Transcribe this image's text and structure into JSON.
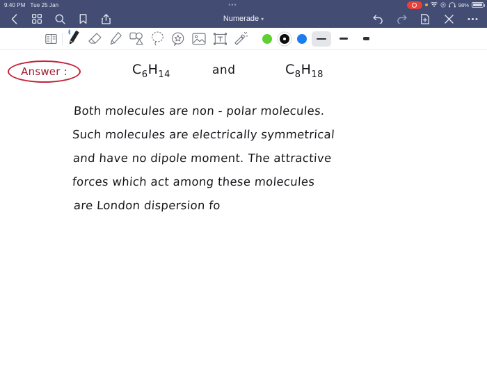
{
  "status_bar": {
    "time": "9:40 PM",
    "date": "Tue 25 Jan",
    "recording_icon": "record-dot-icon",
    "orange_dot_icon": "orange-indicator-dot-icon",
    "wifi_icon": "wifi-icon",
    "settings_icon": "gear-icon",
    "headphones_icon": "headphones-icon",
    "battery_percent": "98%",
    "battery_icon": "battery-icon",
    "handle_dots": "•••"
  },
  "nav_bar": {
    "title": "Numerade",
    "title_chevron": "▾",
    "left_items": [
      {
        "name": "back-button",
        "icon": "chevron-left-icon"
      },
      {
        "name": "thumbnails-button",
        "icon": "grid-icon"
      },
      {
        "name": "search-button",
        "icon": "search-icon"
      },
      {
        "name": "bookmark-button",
        "icon": "bookmark-icon"
      },
      {
        "name": "share-button",
        "icon": "share-icon"
      }
    ],
    "right_items": [
      {
        "name": "undo-button",
        "icon": "undo-arrow-icon"
      },
      {
        "name": "redo-button",
        "icon": "redo-arrow-icon"
      },
      {
        "name": "add-page-button",
        "icon": "document-plus-icon"
      },
      {
        "name": "close-button",
        "icon": "close-x-icon"
      },
      {
        "name": "more-button",
        "icon": "ellipsis-icon"
      }
    ]
  },
  "toolbar": {
    "tools": [
      {
        "name": "page-layout-tool",
        "icon": "page-layout-icon",
        "selected": false
      },
      {
        "name": "pen-tool",
        "icon": "pen-icon",
        "selected": true,
        "badge": "bluetooth-icon"
      },
      {
        "name": "eraser-tool",
        "icon": "eraser-icon",
        "selected": false
      },
      {
        "name": "highlighter-tool",
        "icon": "highlighter-icon",
        "selected": false
      },
      {
        "name": "shapes-tool",
        "icon": "shapes-icon",
        "selected": false
      },
      {
        "name": "lasso-tool",
        "icon": "lasso-icon",
        "selected": false
      },
      {
        "name": "sticker-tool",
        "icon": "sticker-star-icon",
        "selected": false
      },
      {
        "name": "image-tool",
        "icon": "image-icon",
        "selected": false
      },
      {
        "name": "text-tool",
        "icon": "text-box-icon",
        "selected": false
      },
      {
        "name": "laser-tool",
        "icon": "magic-wand-icon",
        "selected": false
      }
    ],
    "colors": [
      {
        "name": "color-swatch-green",
        "hex": "#5fd02f",
        "active": false
      },
      {
        "name": "color-swatch-black",
        "hex": "#0d0d0d",
        "active": true
      },
      {
        "name": "color-swatch-blue",
        "hex": "#1a7ef0",
        "active": false
      }
    ],
    "stroke_widths": [
      {
        "name": "stroke-width-thin",
        "active": true,
        "w": 14,
        "h": 2
      },
      {
        "name": "stroke-width-medium",
        "active": false,
        "w": 12,
        "h": 3
      },
      {
        "name": "stroke-width-thick",
        "active": false,
        "w": 9,
        "h": 4
      }
    ]
  },
  "canvas": {
    "answer_label": "Answer :",
    "answer_circle_color": "#c12237",
    "formula_left": "C6H14",
    "formula_left_parts": {
      "c": "C",
      "c_sub": "6",
      "h": "H",
      "h_sub": "14"
    },
    "conjunction": "and",
    "formula_right_parts": {
      "c": "C",
      "c_sub": "8",
      "h": "H",
      "h_sub": "18"
    },
    "lines": [
      "Both   molecules   are    non - polar   molecules.",
      "Such   molecules   are   electrically   symmetrical",
      "and    have   no    dipole   moment. The  attractive",
      "forces    which    act   among   these    molecules",
      "are    London   dispersion   fo"
    ]
  }
}
